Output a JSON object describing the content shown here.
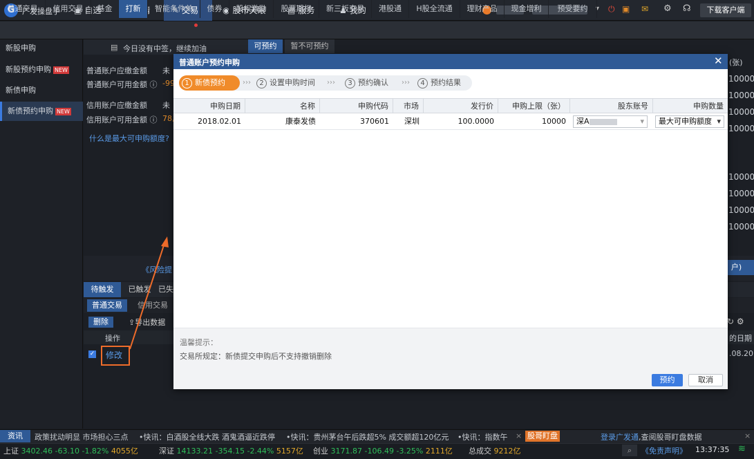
{
  "app": {
    "name": "广发操盘手",
    "download_btn": "下载客户端"
  },
  "topnav": [
    {
      "label": "自选",
      "icon": "star-icon"
    },
    {
      "label": "行情",
      "icon": "chart-icon"
    },
    {
      "label": "交易",
      "icon": "trade-icon"
    },
    {
      "label": "股市天眼",
      "icon": "eye-icon"
    },
    {
      "label": "服务",
      "icon": "briefcase-icon"
    },
    {
      "label": "我的",
      "icon": "user-icon"
    }
  ],
  "subnav": [
    "普通交易",
    "信用交易",
    "基金",
    "打新",
    "智能条件单",
    "债券",
    "股权激励",
    "股票期权",
    "新三板交易",
    "港股通",
    "H股全流通",
    "理财产品",
    "现金增利",
    "预受要约"
  ],
  "sidebar": [
    "新股申购",
    "新股预约申购",
    "新债申购",
    "新债预约申购"
  ],
  "new_badge": "NEW",
  "main": {
    "notice": "今日没有中签，继续加油",
    "tab_available": "可预约",
    "tab_unavailable": "暂不可预约",
    "labels": [
      "普通账户应缴金额",
      "普通账户可用金额",
      "信用账户应缴金额",
      "信用账户可用金额"
    ],
    "values": [
      "未",
      "-99",
      "未",
      "78,"
    ],
    "help_q": "什么是最大可申购额度?",
    "right_header": "(张)",
    "right_nums": [
      "10000",
      "10000",
      "10000",
      "10000",
      "10000",
      "10000",
      "10000",
      "10000"
    ],
    "risk_link": "《风险提",
    "right_btn": "户)"
  },
  "bottom": {
    "tabs": [
      "待触发",
      "已触发",
      "已失"
    ],
    "subtabs": [
      "普通交易",
      "信用交易"
    ],
    "delete_btn": "删除",
    "export": "导出数据",
    "op_header": "操作",
    "modify": "修改",
    "date_header": "的日期",
    "date_val": ".08.20"
  },
  "modal": {
    "title": "普通账户预约申购",
    "steps": [
      {
        "num": "1",
        "label": "新债预约"
      },
      {
        "num": "2",
        "label": "设置申购时间"
      },
      {
        "num": "3",
        "label": "预约确认"
      },
      {
        "num": "4",
        "label": "预约结果"
      }
    ],
    "arrows": "›››",
    "columns": [
      "申购日期",
      "名称",
      "申购代码",
      "市场",
      "发行价",
      "申购上限（张）",
      "股东账号",
      "申购数量"
    ],
    "row": {
      "date": "2018.02.01",
      "name": "康泰发债",
      "code": "370601",
      "market": "深圳",
      "price": "100.0000",
      "limit": "10000",
      "account_prefix": "深A",
      "qty": "最大可申购额度"
    },
    "tip_title": "温馨提示：",
    "tip_text": "交易所规定：新债提交申购后不支持撤销删除",
    "confirm": "预约",
    "cancel": "取消"
  },
  "news": {
    "label": "资讯",
    "items": [
      "政策扰动明显 市场担心三点",
      "•快讯：白酒股全线大跌 酒鬼酒逼近跌停",
      "•快讯：贵州茅台午后跌超5% 成交额超120亿元",
      "•快讯：指数午"
    ],
    "tag": "股哥盯盘",
    "login": "登录广发通",
    "login_rest": ",查阅股哥盯盘数据"
  },
  "status": {
    "sh_label": "上证",
    "sh": "3402.46",
    "sh_chg": "-63.10",
    "sh_pct": "-1.82%",
    "sh_amt": "4055亿",
    "sz_label": "深证",
    "sz": "14133.21",
    "sz_chg": "-354.15",
    "sz_pct": "-2.44%",
    "sz_amt": "5157亿",
    "cy_label": "创业",
    "cy": "3171.87",
    "cy_chg": "-106.49",
    "cy_pct": "-3.25%",
    "cy_amt": "2111亿",
    "total_label": "总成交",
    "total": "9212亿",
    "disclaimer": "《免责声明》",
    "time": "13:37:35"
  }
}
